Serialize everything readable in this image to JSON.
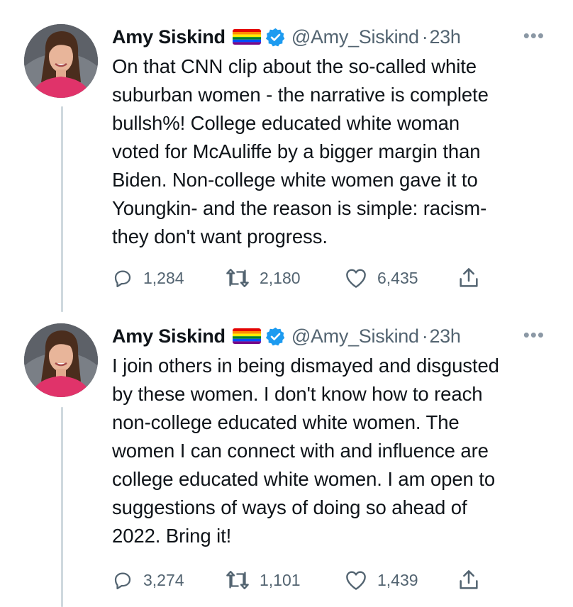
{
  "tweets": [
    {
      "author_name": "Amy Siskind",
      "handle": "@Amy_Siskind",
      "separator": "·",
      "time": "23h",
      "more": "•••",
      "lines": [
        "On that CNN clip about the so-called white",
        "suburban women - the narrative is complete",
        "bullsh%!  College educated white woman",
        "voted for McAuliffe by a bigger margin than",
        "Biden. Non-college white women gave it to",
        "Youngkin- and the reason is simple: racism-",
        "they don't want progress."
      ],
      "replies": "1,284",
      "retweets": "2,180",
      "likes": "6,435"
    },
    {
      "author_name": "Amy Siskind",
      "handle": "@Amy_Siskind",
      "separator": "·",
      "time": "23h",
      "more": "•••",
      "lines": [
        "I join others in being dismayed and disgusted",
        "by these women.  I don't know how to reach",
        "non-college educated white women.  The",
        "women I can connect with and influence are",
        "college educated white women. I am open to",
        "suggestions of ways of doing so ahead of",
        "2022.  Bring it!"
      ],
      "replies": "3,274",
      "retweets": "1,101",
      "likes": "1,439"
    }
  ],
  "icons": {
    "reply": "reply-icon",
    "retweet": "retweet-icon",
    "like": "heart-icon",
    "share": "share-icon",
    "verified": "verified-badge-icon",
    "flag": "rainbow-flag-icon"
  },
  "colors": {
    "text": "#0f1419",
    "muted": "#536471",
    "verified": "#1d9bf0",
    "thread_line": "#cfd9de"
  }
}
